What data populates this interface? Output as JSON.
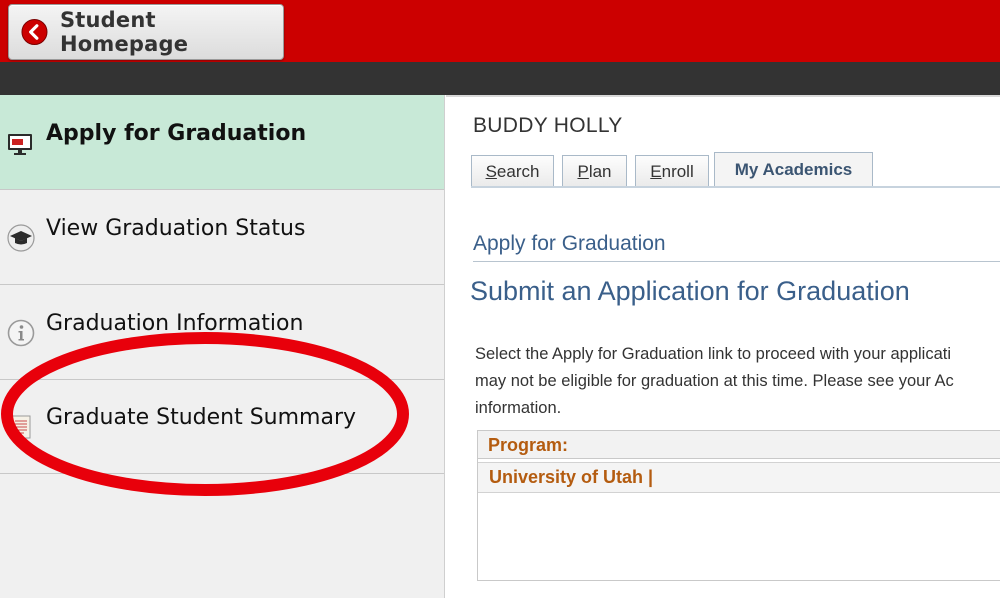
{
  "header": {
    "home_button_label": "Student Homepage",
    "colors": {
      "brand_red": "#cc0000",
      "dark_bar": "#333333"
    }
  },
  "sidebar": {
    "items": [
      {
        "label": "Apply for Graduation",
        "icon": "monitor-certificate-icon",
        "active": true
      },
      {
        "label": "View Graduation Status",
        "icon": "graduation-cap-icon",
        "active": false
      },
      {
        "label": "Graduation Information",
        "icon": "info-icon",
        "active": false
      },
      {
        "label": "Graduate Student Summary",
        "icon": "scroll-document-icon",
        "active": false
      }
    ],
    "active_color": "#c8e9d7"
  },
  "main": {
    "student_name": "BUDDY HOLLY",
    "tabs": [
      {
        "hotkey": "S",
        "rest": "earch",
        "active": false
      },
      {
        "hotkey": "P",
        "rest": "lan",
        "active": false
      },
      {
        "hotkey": "E",
        "rest": "nroll",
        "active": false
      },
      {
        "hotkey": "",
        "rest": "My Academics",
        "active": true
      }
    ],
    "page_heading": "Apply for Graduation",
    "page_subheading": "Submit an Application for Graduation",
    "instructions": "Select the Apply for Graduation link to proceed with your applicati\nmay not be eligible for graduation at this time. Please see your Ac\ninformation.",
    "program": {
      "header": "Program:",
      "value": "University of Utah |"
    }
  },
  "annotation": {
    "color": "#e8000b"
  }
}
